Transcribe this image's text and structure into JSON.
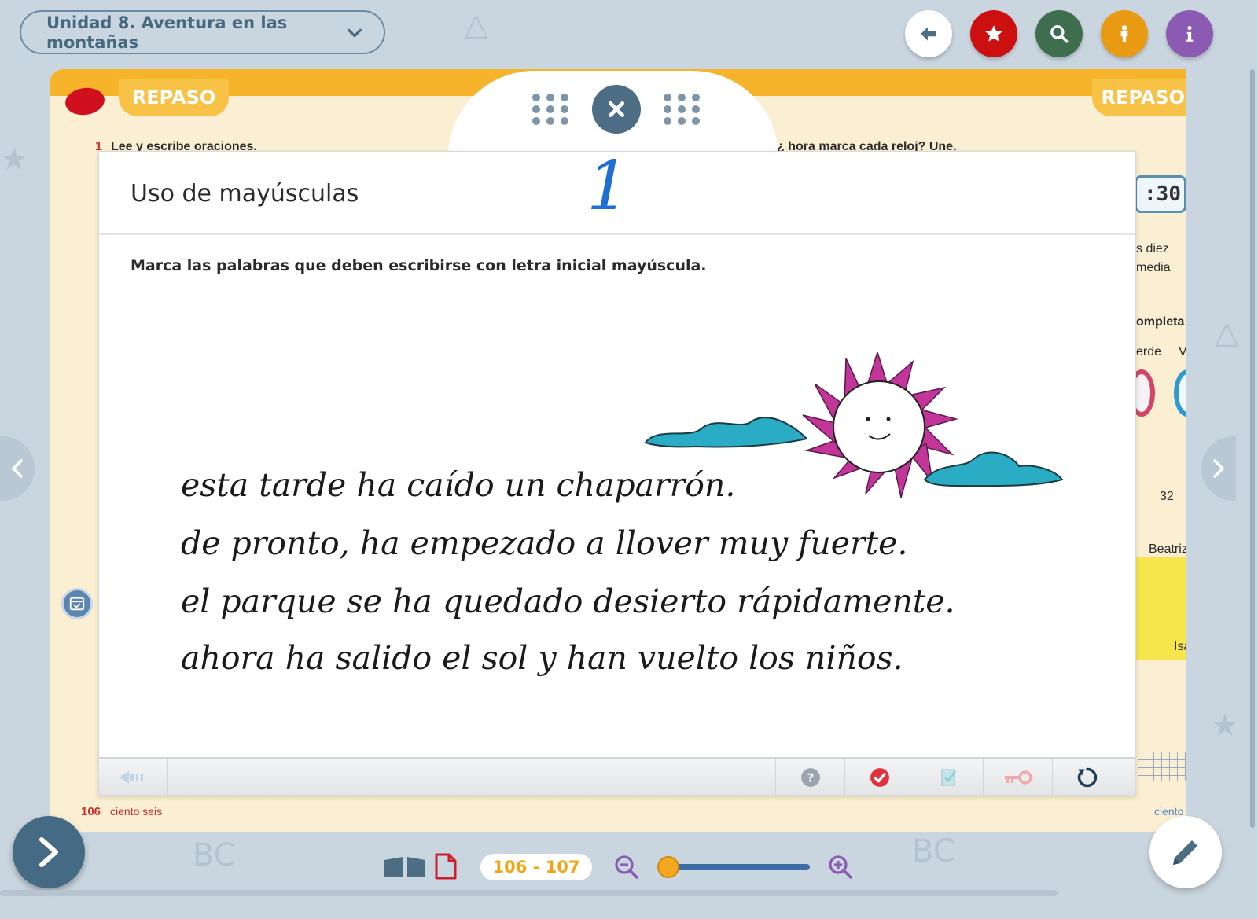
{
  "header": {
    "unit_title": "Unidad 8. Aventura en las montañas"
  },
  "book": {
    "section_label_left": "REPASO",
    "section_label_right": "REPASO",
    "left_exercise_num": "1",
    "left_exercise_text": "Lee y escribe oraciones.",
    "right_exercise_text": "¿ hora marca cada reloj? Une.",
    "right_fragments": {
      "clock": ":30",
      "diez": "s diez",
      "media": "media",
      "completa": "ompleta",
      "verde": "erde",
      "v": "V",
      "num": "32",
      "beatriz": "Beatriz",
      "isa": "Isa"
    },
    "left_page_number": "106",
    "left_page_words": "ciento seis",
    "right_page_words": "ciento"
  },
  "modal": {
    "title": "Uso de mayúsculas",
    "handwritten_mark": "1",
    "instruction": "Marca las palabras que deben escribirse con letra inicial mayúscula.",
    "sentences": [
      "esta tarde ha caído un chaparrón.",
      "de pronto, ha empezado a llover muy fuerte.",
      "el parque se ha quedado desierto rápidamente.",
      "ahora ha salido el sol y han vuelto los niños."
    ]
  },
  "toolbar": {
    "page_range": "106 - 107"
  },
  "colors": {
    "accent": "#f2a516",
    "modal_dark": "#4c6d84",
    "sun_petal": "#c2369a",
    "cloud": "#2aacc4",
    "star_button": "#cc1010",
    "search_button": "#3f6e4f",
    "person_button": "#e89b12",
    "info_button": "#8b5bb3"
  }
}
